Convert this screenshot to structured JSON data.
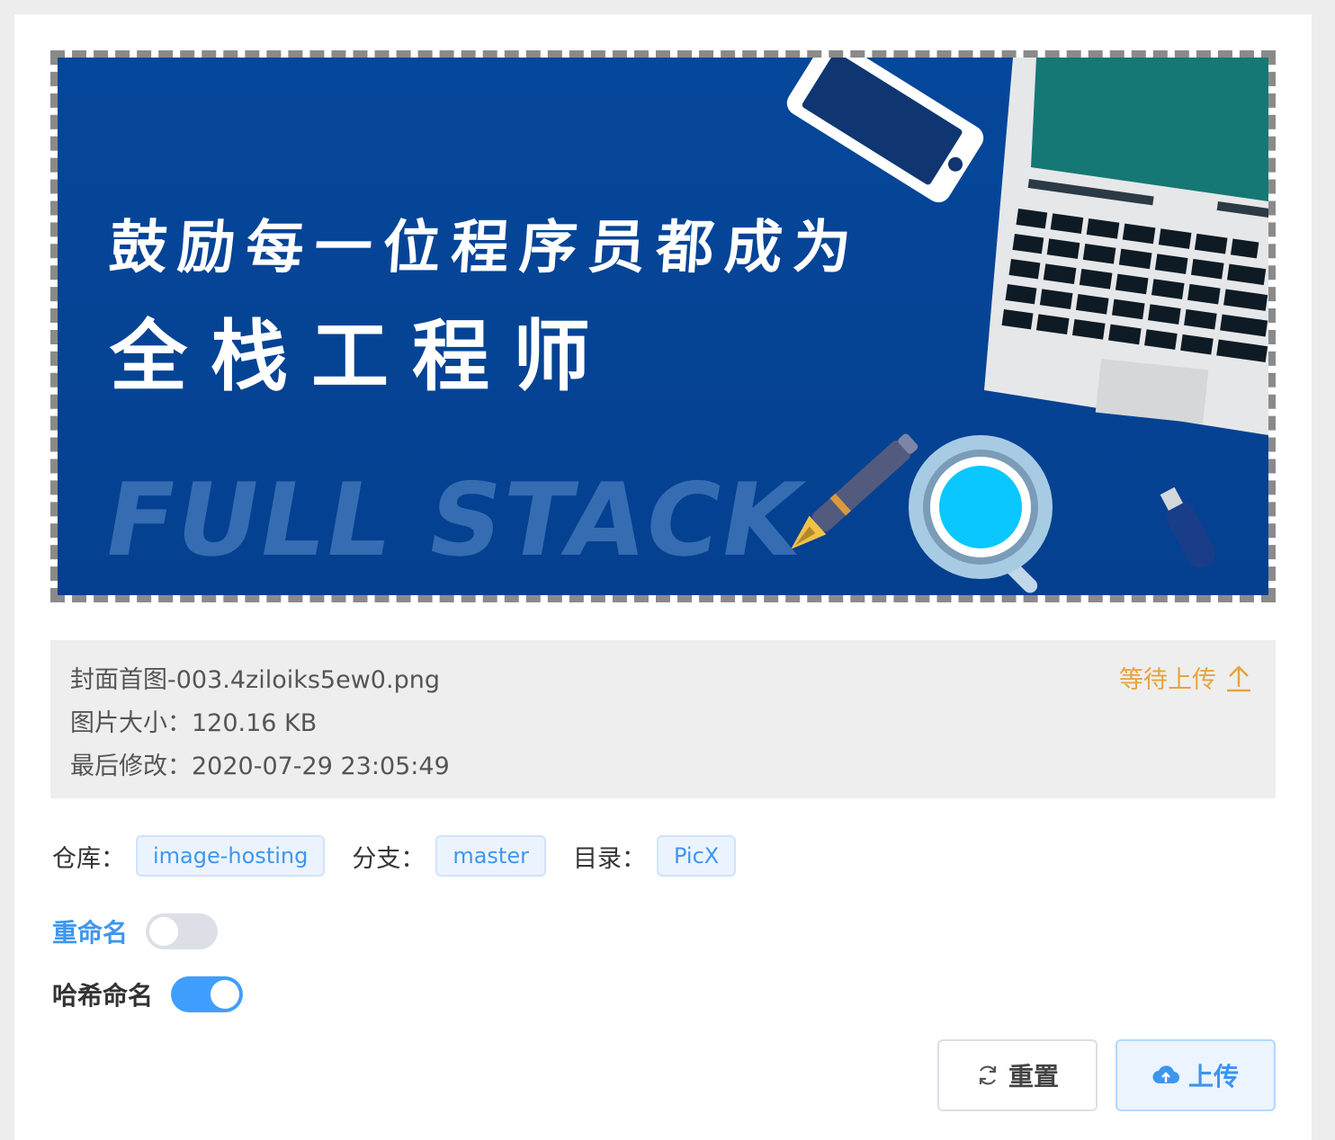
{
  "preview": {
    "headline_line1": "鼓励每一位程序员都成为",
    "headline_line2": "全栈工程师",
    "watermark": "FULL STACK"
  },
  "file": {
    "name": "封面首图-003.4ziloiks5ew0.png",
    "size": "图片大小：120.16 KB",
    "modified": "最后修改：2020-07-29 23:05:49",
    "status": "等待上传"
  },
  "meta": {
    "repo_label": "仓库：",
    "repo_value": "image-hosting",
    "branch_label": "分支：",
    "branch_value": "master",
    "dir_label": "目录：",
    "dir_value": "PicX"
  },
  "options": {
    "rename_label": "重命名",
    "rename_on": false,
    "hash_label": "哈希命名",
    "hash_on": true
  },
  "actions": {
    "reset_label": "重置",
    "upload_label": "上传"
  },
  "colors": {
    "accent": "#409eff",
    "status": "#e8a33b",
    "switch_off": "#dcdfe6",
    "preview_bg": "#05479a"
  },
  "icons": {
    "status": "arrow-up-icon",
    "reset": "refresh-icon",
    "upload": "cloud-upload-icon"
  }
}
